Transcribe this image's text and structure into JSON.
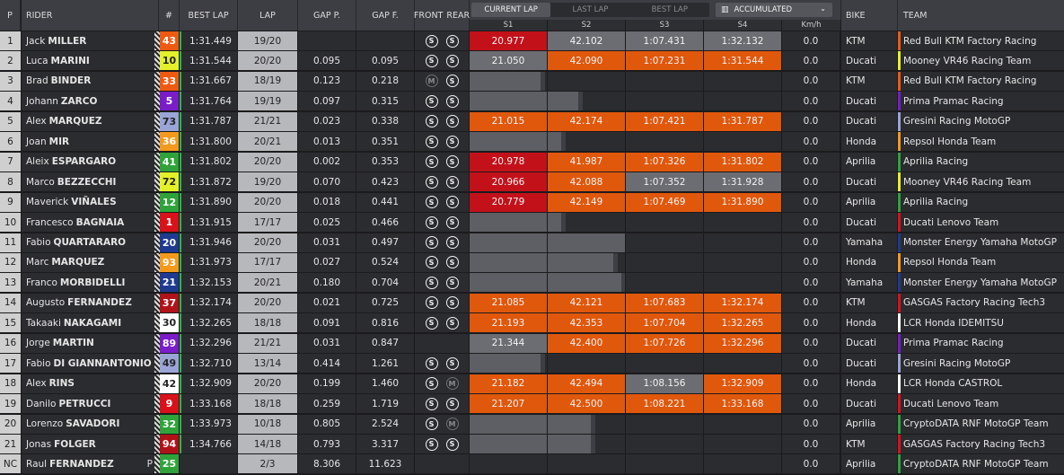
{
  "header": {
    "pos": "P",
    "rider": "RIDER",
    "num": "#",
    "best": "BEST LAP",
    "lap": "LAP",
    "gap_p": "GAP P.",
    "gap_f": "GAP F.",
    "front": "FRONT",
    "rear": "REAR",
    "bike": "BIKE",
    "team": "TEAM",
    "tabs": [
      "CURRENT LAP",
      "LAST LAP",
      "BEST LAP"
    ],
    "active_tab": 0,
    "accumulated": "ACCUMULATED",
    "sectors": [
      "S1",
      "S2",
      "S3",
      "S4"
    ],
    "kmh": "Km/h"
  },
  "colors": {
    "red_sector": "#c3111a",
    "orange_sector": "#e0580c",
    "grey_sector": "#6c6d72",
    "best_lap_marker": "#2fb34a"
  },
  "rows": [
    {
      "pos": "1",
      "first": "Jack",
      "last": "MILLER",
      "num": "43",
      "num_bg": "#ee5a12",
      "num_fg": "#ffffff",
      "best": "1:31.449",
      "lap": "19/20",
      "gap_p": "",
      "gap_f": "",
      "front": "S",
      "rear": "S",
      "s": [
        [
          "20.977",
          "red"
        ],
        [
          "42.102",
          "grey"
        ],
        [
          "1:07.431",
          "grey"
        ],
        [
          "1:32.132",
          "grey"
        ]
      ],
      "kmh": "0.0",
      "bike": "KTM",
      "team": "Red Bull KTM Factory Racing",
      "team_color": "#ee5a12"
    },
    {
      "pos": "2",
      "first": "Luca",
      "last": "MARINI",
      "num": "10",
      "num_bg": "#e4f02a",
      "num_fg": "#222222",
      "best": "1:31.544",
      "lap": "20/20",
      "gap_p": "0.095",
      "gap_f": "0.095",
      "front": "S",
      "rear": "S",
      "s": [
        [
          "21.050",
          "grey"
        ],
        [
          "42.090",
          "orange"
        ],
        [
          "1:07.231",
          "orange"
        ],
        [
          "1:31.544",
          "orange"
        ]
      ],
      "kmh": "0.0",
      "bike": "Ducati",
      "team": "Mooney VR46 Racing Team",
      "team_color": "#e4f02a"
    },
    {
      "pos": "3",
      "first": "Brad",
      "last": "BINDER",
      "num": "33",
      "num_bg": "#ee5a12",
      "num_fg": "#ffffff",
      "best": "1:31.667",
      "lap": "18/19",
      "gap_p": "0.123",
      "gap_f": "0.218",
      "front": "M",
      "rear": "S",
      "s": [
        [
          "",
          "bar",
          0.92
        ],
        [
          "",
          "",
          0
        ],
        [
          "",
          "",
          0
        ],
        [
          "",
          "",
          0
        ]
      ],
      "kmh": "0.0",
      "bike": "KTM",
      "team": "Red Bull KTM Factory Racing",
      "team_color": "#ee5a12"
    },
    {
      "pos": "4",
      "first": "Johann",
      "last": "ZARCO",
      "num": "5",
      "num_bg": "#7a1cc7",
      "num_fg": "#ffffff",
      "best": "1:31.764",
      "lap": "19/19",
      "gap_p": "0.097",
      "gap_f": "0.315",
      "front": "S",
      "rear": "S",
      "s": [
        [
          "",
          "bar",
          1.0
        ],
        [
          "",
          "bar",
          0.4
        ],
        [
          "",
          "",
          0
        ],
        [
          "",
          "",
          0
        ]
      ],
      "kmh": "0.0",
      "bike": "Ducati",
      "team": "Prima Pramac Racing",
      "team_color": "#7a1cc7"
    },
    {
      "pos": "5",
      "first": "Alex",
      "last": "MARQUEZ",
      "num": "73",
      "num_bg": "#9aa4d6",
      "num_fg": "#222222",
      "best": "1:31.787",
      "lap": "21/21",
      "gap_p": "0.023",
      "gap_f": "0.338",
      "front": "S",
      "rear": "S",
      "s": [
        [
          "21.015",
          "orange"
        ],
        [
          "42.174",
          "orange"
        ],
        [
          "1:07.421",
          "orange"
        ],
        [
          "1:31.787",
          "orange"
        ]
      ],
      "kmh": "0.0",
      "bike": "Ducati",
      "team": "Gresini Racing MotoGP",
      "team_color": "#9aa4d6"
    },
    {
      "pos": "6",
      "first": "Joan",
      "last": "MIR",
      "num": "36",
      "num_bg": "#f39a1e",
      "num_fg": "#ffffff",
      "best": "1:31.800",
      "lap": "20/21",
      "gap_p": "0.013",
      "gap_f": "0.351",
      "front": "S",
      "rear": "S",
      "s": [
        [
          "",
          "bar",
          1.0
        ],
        [
          "",
          "bar",
          0.18
        ],
        [
          "",
          "",
          0
        ],
        [
          "",
          "",
          0
        ]
      ],
      "kmh": "0.0",
      "bike": "Honda",
      "team": "Repsol Honda Team",
      "team_color": "#f39a1e"
    },
    {
      "pos": "7",
      "first": "Aleix",
      "last": "ESPARGARO",
      "num": "41",
      "num_bg": "#2fa33a",
      "num_fg": "#ffffff",
      "best": "1:31.802",
      "lap": "20/20",
      "gap_p": "0.002",
      "gap_f": "0.353",
      "front": "S",
      "rear": "S",
      "s": [
        [
          "20.978",
          "red"
        ],
        [
          "41.987",
          "orange"
        ],
        [
          "1:07.326",
          "orange"
        ],
        [
          "1:31.802",
          "orange"
        ]
      ],
      "kmh": "0.0",
      "bike": "Aprilia",
      "team": "Aprilia Racing",
      "team_color": "#2fa33a"
    },
    {
      "pos": "8",
      "first": "Marco",
      "last": "BEZZECCHI",
      "num": "72",
      "num_bg": "#e4f02a",
      "num_fg": "#222222",
      "best": "1:31.872",
      "lap": "19/20",
      "gap_p": "0.070",
      "gap_f": "0.423",
      "front": "S",
      "rear": "S",
      "s": [
        [
          "20.966",
          "red"
        ],
        [
          "42.088",
          "orange"
        ],
        [
          "1:07.352",
          "grey"
        ],
        [
          "1:31.928",
          "grey"
        ]
      ],
      "kmh": "0.0",
      "bike": "Ducati",
      "team": "Mooney VR46 Racing Team",
      "team_color": "#e4f02a"
    },
    {
      "pos": "9",
      "first": "Maverick",
      "last": "VIÑALES",
      "num": "12",
      "num_bg": "#2fa33a",
      "num_fg": "#ffffff",
      "best": "1:31.890",
      "lap": "20/20",
      "gap_p": "0.018",
      "gap_f": "0.441",
      "front": "S",
      "rear": "S",
      "s": [
        [
          "20.779",
          "red"
        ],
        [
          "42.149",
          "orange"
        ],
        [
          "1:07.469",
          "orange"
        ],
        [
          "1:31.890",
          "orange"
        ]
      ],
      "kmh": "0.0",
      "bike": "Aprilia",
      "team": "Aprilia Racing",
      "team_color": "#2fa33a"
    },
    {
      "pos": "10",
      "first": "Francesco",
      "last": "BAGNAIA",
      "num": "1",
      "num_bg": "#d8121a",
      "num_fg": "#ffffff",
      "best": "1:31.915",
      "lap": "17/17",
      "gap_p": "0.025",
      "gap_f": "0.466",
      "front": "S",
      "rear": "S",
      "s": [
        [
          "",
          "bar",
          1.0
        ],
        [
          "",
          "bar",
          0.18
        ],
        [
          "",
          "",
          0
        ],
        [
          "",
          "",
          0
        ]
      ],
      "kmh": "0.0",
      "bike": "Ducati",
      "team": "Ducati Lenovo Team",
      "team_color": "#d8121a"
    },
    {
      "pos": "11",
      "first": "Fabio",
      "last": "QUARTARARO",
      "num": "20",
      "num_bg": "#1f3a8f",
      "num_fg": "#ffffff",
      "best": "1:31.946",
      "lap": "20/20",
      "gap_p": "0.031",
      "gap_f": "0.497",
      "front": "S",
      "rear": "S",
      "s": [
        [
          "",
          "bar",
          1.0
        ],
        [
          "",
          "bar",
          1.0
        ],
        [
          "",
          "",
          0
        ],
        [
          "",
          "",
          0
        ]
      ],
      "kmh": "0.0",
      "bike": "Yamaha",
      "team": "Monster Energy Yamaha MotoGP",
      "team_color": "#1f3a8f"
    },
    {
      "pos": "12",
      "first": "Marc",
      "last": "MARQUEZ",
      "num": "93",
      "num_bg": "#f39a1e",
      "num_fg": "#ffffff",
      "best": "1:31.973",
      "lap": "17/17",
      "gap_p": "0.027",
      "gap_f": "0.524",
      "front": "S",
      "rear": "S",
      "s": [
        [
          "",
          "bar",
          1.0
        ],
        [
          "",
          "bar",
          0.85
        ],
        [
          "",
          "",
          0
        ],
        [
          "",
          "",
          0
        ]
      ],
      "kmh": "0.0",
      "bike": "Honda",
      "team": "Repsol Honda Team",
      "team_color": "#f39a1e"
    },
    {
      "pos": "13",
      "first": "Franco",
      "last": "MORBIDELLI",
      "num": "21",
      "num_bg": "#1f3a8f",
      "num_fg": "#ffffff",
      "best": "1:32.153",
      "lap": "20/21",
      "gap_p": "0.180",
      "gap_f": "0.704",
      "front": "S",
      "rear": "S",
      "s": [
        [
          "",
          "bar",
          1.0
        ],
        [
          "",
          "bar",
          0.95
        ],
        [
          "",
          "",
          0
        ],
        [
          "",
          "",
          0
        ]
      ],
      "kmh": "0.0",
      "bike": "Yamaha",
      "team": "Monster Energy Yamaha MotoGP",
      "team_color": "#1f3a8f"
    },
    {
      "pos": "14",
      "first": "Augusto",
      "last": "FERNANDEZ",
      "num": "37",
      "num_bg": "#b0121a",
      "num_fg": "#ffffff",
      "best": "1:32.174",
      "lap": "20/20",
      "gap_p": "0.021",
      "gap_f": "0.725",
      "front": "S",
      "rear": "S",
      "s": [
        [
          "21.085",
          "orange"
        ],
        [
          "42.121",
          "orange"
        ],
        [
          "1:07.683",
          "orange"
        ],
        [
          "1:32.174",
          "orange"
        ]
      ],
      "kmh": "0.0",
      "bike": "KTM",
      "team": "GASGAS Factory Racing Tech3",
      "team_color": "#d8121a"
    },
    {
      "pos": "15",
      "first": "Takaaki",
      "last": "NAKAGAMI",
      "num": "30",
      "num_bg": "#ffffff",
      "num_fg": "#222222",
      "best": "1:32.265",
      "lap": "18/18",
      "gap_p": "0.091",
      "gap_f": "0.816",
      "front": "S",
      "rear": "S",
      "s": [
        [
          "21.193",
          "orange"
        ],
        [
          "42.353",
          "orange"
        ],
        [
          "1:07.704",
          "orange"
        ],
        [
          "1:32.265",
          "orange"
        ]
      ],
      "kmh": "0.0",
      "bike": "Honda",
      "team": "LCR Honda IDEMITSU",
      "team_color": "#ffffff"
    },
    {
      "pos": "16",
      "first": "Jorge",
      "last": "MARTIN",
      "num": "89",
      "num_bg": "#7a1cc7",
      "num_fg": "#ffffff",
      "best": "1:32.296",
      "lap": "21/21",
      "gap_p": "0.031",
      "gap_f": "0.847",
      "front": "",
      "rear": "",
      "s": [
        [
          "21.344",
          "grey"
        ],
        [
          "42.400",
          "orange"
        ],
        [
          "1:07.726",
          "orange"
        ],
        [
          "1:32.296",
          "orange"
        ]
      ],
      "kmh": "0.0",
      "bike": "Ducati",
      "team": "Prima Pramac Racing",
      "team_color": "#7a1cc7"
    },
    {
      "pos": "17",
      "first": "Fabio",
      "last": "DI GIANNANTONIO",
      "num": "49",
      "num_bg": "#9aa4d6",
      "num_fg": "#222222",
      "best": "1:32.710",
      "lap": "13/14",
      "gap_p": "0.414",
      "gap_f": "1.261",
      "front": "S",
      "rear": "S",
      "s": [
        [
          "",
          "bar",
          0.92
        ],
        [
          "",
          "",
          0
        ],
        [
          "",
          "",
          0
        ],
        [
          "",
          "",
          0
        ]
      ],
      "kmh": "0.0",
      "bike": "Ducati",
      "team": "Gresini Racing MotoGP",
      "team_color": "#9aa4d6"
    },
    {
      "pos": "18",
      "first": "Alex",
      "last": "RINS",
      "num": "42",
      "num_bg": "#ffffff",
      "num_fg": "#222222",
      "best": "1:32.909",
      "lap": "20/20",
      "gap_p": "0.199",
      "gap_f": "1.460",
      "front": "S",
      "rear": "M",
      "s": [
        [
          "21.182",
          "orange"
        ],
        [
          "42.494",
          "orange"
        ],
        [
          "1:08.156",
          "grey"
        ],
        [
          "1:32.909",
          "orange"
        ]
      ],
      "kmh": "0.0",
      "bike": "Honda",
      "team": "LCR Honda CASTROL",
      "team_color": "#ffffff"
    },
    {
      "pos": "19",
      "first": "Danilo",
      "last": "PETRUCCI",
      "num": "9",
      "num_bg": "#d8121a",
      "num_fg": "#ffffff",
      "best": "1:33.168",
      "lap": "18/18",
      "gap_p": "0.259",
      "gap_f": "1.719",
      "front": "S",
      "rear": "S",
      "s": [
        [
          "21.207",
          "orange"
        ],
        [
          "42.500",
          "orange"
        ],
        [
          "1:08.221",
          "orange"
        ],
        [
          "1:33.168",
          "orange"
        ]
      ],
      "kmh": "0.0",
      "bike": "Ducati",
      "team": "Ducati Lenovo Team",
      "team_color": "#d8121a"
    },
    {
      "pos": "20",
      "first": "Lorenzo",
      "last": "SAVADORI",
      "num": "32",
      "num_bg": "#2fa33a",
      "num_fg": "#ffffff",
      "best": "1:33.973",
      "lap": "10/18",
      "gap_p": "0.805",
      "gap_f": "2.524",
      "front": "S",
      "rear": "M",
      "s": [
        [
          "",
          "bar",
          1.0
        ],
        [
          "",
          "bar",
          0.56
        ],
        [
          "",
          "",
          0
        ],
        [
          "",
          "",
          0
        ]
      ],
      "kmh": "0.0",
      "bike": "Aprilia",
      "team": "CryptoDATA RNF MotoGP Team",
      "team_color": "#2fa33a"
    },
    {
      "pos": "21",
      "first": "Jonas",
      "last": "FOLGER",
      "num": "94",
      "num_bg": "#b0121a",
      "num_fg": "#ffffff",
      "best": "1:34.766",
      "lap": "14/18",
      "gap_p": "0.793",
      "gap_f": "3.317",
      "front": "S",
      "rear": "S",
      "s": [
        [
          "",
          "bar",
          1.0
        ],
        [
          "",
          "bar",
          0.56
        ],
        [
          "",
          "",
          0
        ],
        [
          "",
          "",
          0
        ]
      ],
      "kmh": "0.0",
      "bike": "KTM",
      "team": "GASGAS Factory Racing Tech3",
      "team_color": "#d8121a"
    },
    {
      "pos": "NC",
      "first": "Raul",
      "last": "FERNANDEZ",
      "pflag": "P",
      "num": "25",
      "num_bg": "#2fa33a",
      "num_fg": "#ffffff",
      "best": "",
      "lap": "2/3",
      "gap_p": "8.306",
      "gap_f": "11.623",
      "front": "",
      "rear": "",
      "s": [
        [
          "",
          "",
          0
        ],
        [
          "",
          "",
          0
        ],
        [
          "",
          "",
          0
        ],
        [
          "",
          "",
          0
        ]
      ],
      "kmh": "0.0",
      "bike": "Aprilia",
      "team": "CryptoDATA RNF MotoGP Team",
      "team_color": "#2fa33a"
    }
  ]
}
